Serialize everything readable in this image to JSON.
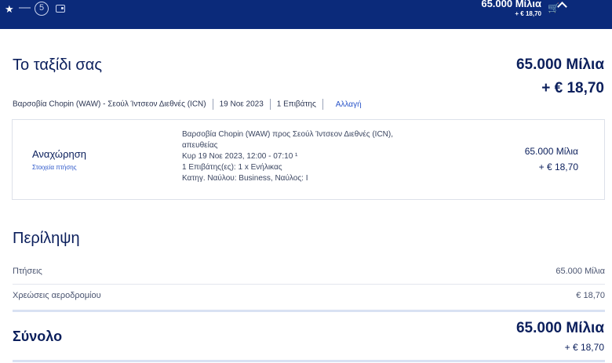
{
  "header": {
    "step_number": "5",
    "miles": "65.000 Μίλια",
    "fee": "+ € 18,70",
    "icons": [
      "star-icon",
      "wallet-icon",
      "cart-icon",
      "chevron-up-icon"
    ]
  },
  "trip": {
    "title": "Το ταξίδι σας",
    "miles": "65.000 Μίλια",
    "fee": "+ € 18,70",
    "route": "Βαρσοβία Chopin (WAW) - Σεούλ Ίντσεον Διεθνές (ICN)",
    "date": "19 Νοε 2023",
    "passengers": "1 Επιβάτης",
    "change_label": "Αλλαγή"
  },
  "flight_card": {
    "label": "Αναχώρηση",
    "details_link": "Στοιχεία πτήσης",
    "info_lines": [
      "Βαρσοβία Chopin (WAW) προς Σεούλ Ίντσεον Διεθνές (ICN),",
      "απευθείας",
      "Κυρ 19 Νοε 2023, 12:00 - 07:10 ¹",
      "1 Επιβάτης(ες): 1 x Ενήλικας",
      "Κατηγ. Ναύλου: Business, Ναύλος: I"
    ],
    "miles": "65.000 Μίλια",
    "fee": "+ € 18,70"
  },
  "summary": {
    "title": "Περίληψη",
    "rows": [
      {
        "label": "Πτήσεις",
        "value": "65.000 Μίλια"
      },
      {
        "label": "Χρεώσεις αεροδρομίου",
        "value": "€ 18,70"
      }
    ]
  },
  "total": {
    "label": "Σύνολο",
    "miles": "65.000 Μίλια",
    "fee": "+ € 18,70"
  },
  "colors": {
    "header_bg": "#0b2a7a",
    "text_primary": "#0b1f5c",
    "link": "#2a55c9"
  }
}
